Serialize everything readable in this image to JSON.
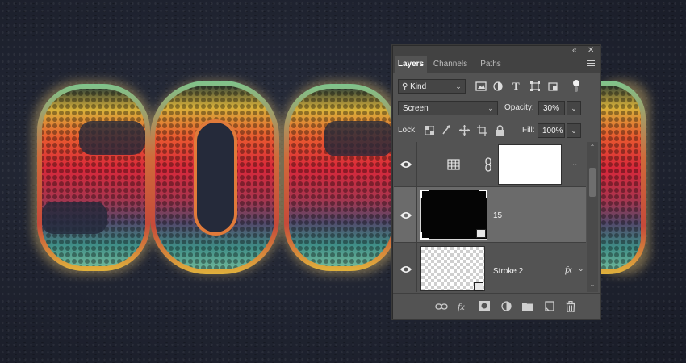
{
  "canvas": {
    "artwork_text": "SOGO",
    "background_color": "#1f2330"
  },
  "panel": {
    "collapse_icon": "double-chevron-icon",
    "close_icon": "close-icon",
    "tabs": [
      {
        "label": "Layers",
        "active": true
      },
      {
        "label": "Channels",
        "active": false
      },
      {
        "label": "Paths",
        "active": false
      }
    ],
    "filter": {
      "kind_label": "Kind",
      "icons": [
        "image-filter-icon",
        "adjustment-filter-icon",
        "type-filter-icon",
        "shape-filter-icon",
        "smart-object-filter-icon",
        "filter-toggle-icon"
      ]
    },
    "blend_mode": "Screen",
    "opacity_label": "Opacity:",
    "opacity_value": "30%",
    "lock_label": "Lock:",
    "fill_label": "Fill:",
    "fill_value": "100%",
    "layers": [
      {
        "name": "",
        "type": "adjustment",
        "more": "...",
        "thumb_color": "#ffffff",
        "selected": false
      },
      {
        "name": "15",
        "type": "smart-object",
        "thumb_color": "#050505",
        "selected": true
      },
      {
        "name": "Stroke 2",
        "type": "text-smart",
        "fx": "fx",
        "selected": false
      }
    ],
    "bottom_icons": [
      "link-layers-icon",
      "fx-icon",
      "mask-icon",
      "adjustment-icon",
      "folder-icon",
      "new-layer-icon",
      "trash-icon"
    ],
    "accent": "#535353"
  }
}
